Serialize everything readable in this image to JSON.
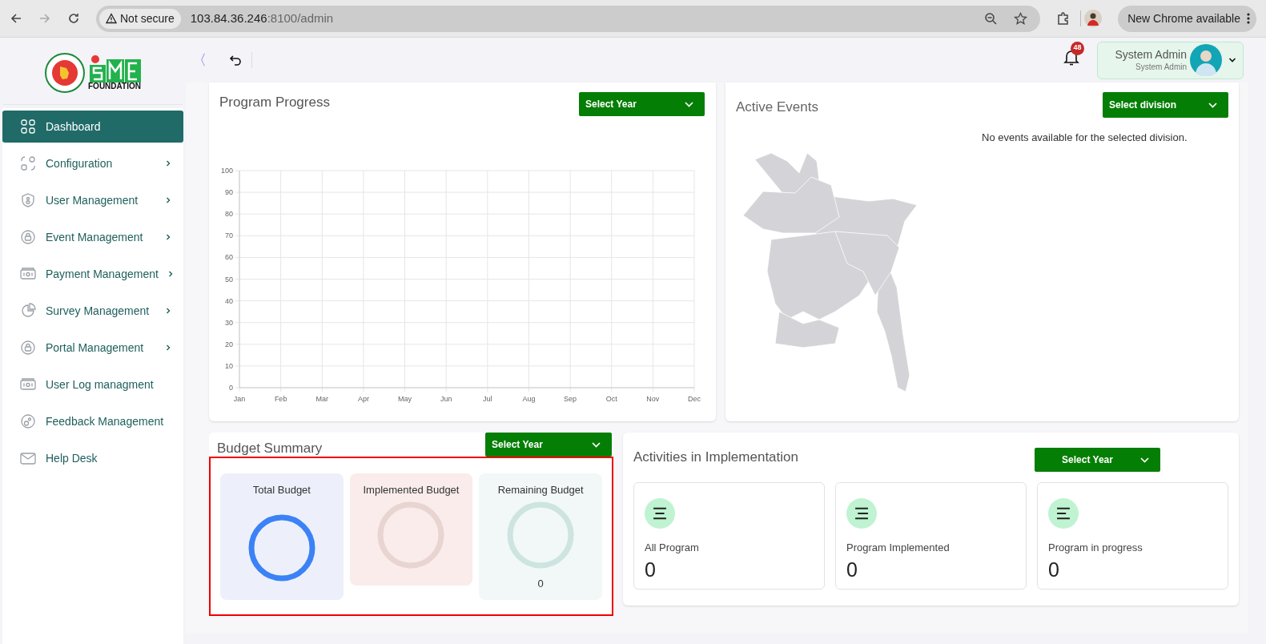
{
  "browser": {
    "security_label": "Not secure",
    "url_host": "103.84.36.246",
    "url_rest": ":8100/admin",
    "update_label": "New Chrome available"
  },
  "header": {
    "logo_text": "FOUNDATION",
    "collapse_glyph": "〈",
    "notification_count": "48",
    "user_name": "System Admin",
    "user_role": "System Admin"
  },
  "sidebar": {
    "items": [
      {
        "label": "Dashboard",
        "selected": true,
        "expandable": false
      },
      {
        "label": "Configuration",
        "selected": false,
        "expandable": true
      },
      {
        "label": "User Management",
        "selected": false,
        "expandable": true
      },
      {
        "label": "Event Management",
        "selected": false,
        "expandable": true
      },
      {
        "label": "Payment Management",
        "selected": false,
        "expandable": true
      },
      {
        "label": "Survey Management",
        "selected": false,
        "expandable": true
      },
      {
        "label": "Portal Management",
        "selected": false,
        "expandable": true
      },
      {
        "label": "User Log managment",
        "selected": false,
        "expandable": false
      },
      {
        "label": "Feedback Management",
        "selected": false,
        "expandable": false
      },
      {
        "label": "Help Desk",
        "selected": false,
        "expandable": false
      }
    ]
  },
  "program_progress": {
    "title": "Program Progress",
    "dropdown": "Select Year",
    "chart_data": {
      "type": "line",
      "categories": [
        "Jan",
        "Feb",
        "Mar",
        "Apr",
        "May",
        "Jun",
        "Jul",
        "Aug",
        "Sep",
        "Oct",
        "Nov",
        "Dec"
      ],
      "grid": true,
      "ylim": [
        0,
        100
      ],
      "yticks": [
        0,
        10,
        20,
        30,
        40,
        50,
        60,
        70,
        80,
        90,
        100
      ]
    }
  },
  "active_events": {
    "title": "Active Events",
    "dropdown": "Select division",
    "message": "No events available for the selected division."
  },
  "budget_summary": {
    "title": "Budget Summary",
    "dropdown": "Select Year",
    "cards": [
      {
        "label": "Total Budget",
        "color": "#3b82f6"
      },
      {
        "label": "Implemented Budget",
        "color": "#e8d4d0"
      },
      {
        "label": "Remaining Budget",
        "color": "#cde4e0",
        "value": "0"
      }
    ]
  },
  "activities": {
    "title": "Activities in Implementation",
    "dropdown": "Select Year",
    "cards": [
      {
        "label": "All Program",
        "value": "0"
      },
      {
        "label": "Program Implemented",
        "value": "0"
      },
      {
        "label": "Program in progress",
        "value": "0"
      }
    ]
  }
}
